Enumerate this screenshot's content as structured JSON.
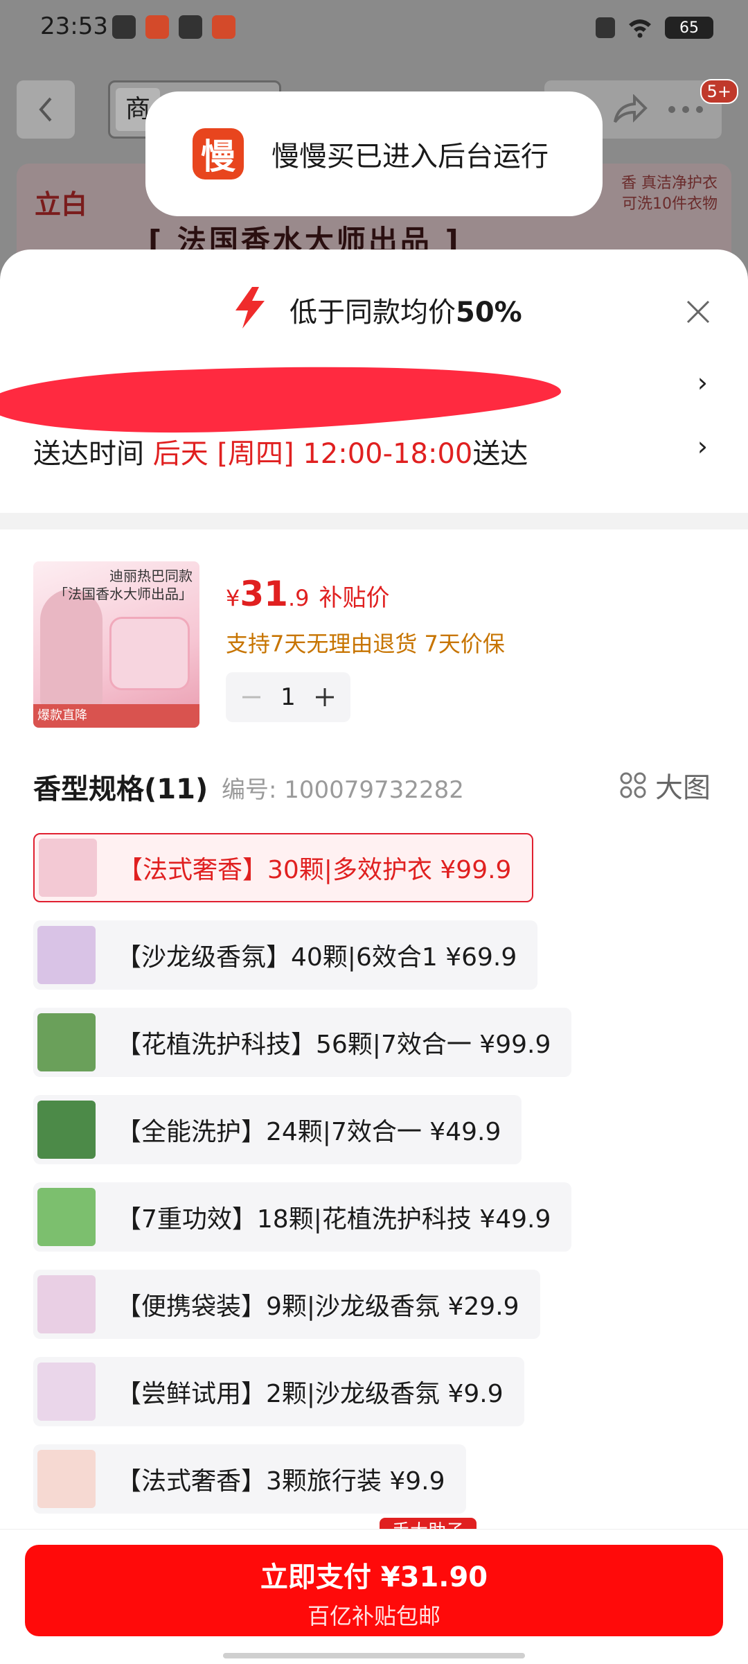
{
  "status_bar": {
    "time": "23:53",
    "battery": "65"
  },
  "background_page": {
    "search_tab": "商",
    "cart_badge": "5+",
    "banner_brand": "立白",
    "banner_title": "[ 法国香水大师出品 ]",
    "banner_right_line1": "香 真洁净护衣",
    "banner_right_line2": "可洗10件衣物"
  },
  "toast": {
    "logo_char": "慢",
    "message": "慢慢买已进入后台运行"
  },
  "sheet": {
    "title_prefix": "低于同款均价",
    "title_value": "50%",
    "delivery_label": "送达时间",
    "delivery_time": "后天 [周四] 12:00-18:00",
    "delivery_suffix": "送达",
    "chevron": "›"
  },
  "product": {
    "image_top_text1": "迪丽热巴同款",
    "image_top_text2": "「法国香水大师出品」",
    "image_tag": "爆款直降",
    "currency": "¥",
    "price_int": "31",
    "price_dec": ".9",
    "price_label": "补贴价",
    "guarantee": "支持7天无理由退货  7天价保",
    "qty": "1"
  },
  "spec": {
    "header": "香型规格(11)",
    "code": "编号: 100079732282",
    "big_image_label": "大图",
    "options": [
      {
        "label": "【法式奢香】30颗|多效护衣   ¥99.9",
        "selected": true,
        "thumb_color": "#f3c9d4"
      },
      {
        "label": "【沙龙级香氛】40颗|6效合1   ¥69.9",
        "selected": false,
        "thumb_color": "#d9c3e6"
      },
      {
        "label": "【花植洗护科技】56颗|7效合一   ¥99.9",
        "selected": false,
        "thumb_color": "#6aa05a"
      },
      {
        "label": "【全能洗护】24颗|7效合一   ¥49.9",
        "selected": false,
        "thumb_color": "#4c8a48"
      },
      {
        "label": "【7重功效】18颗|花植洗护科技   ¥49.9",
        "selected": false,
        "thumb_color": "#7cbf6e"
      },
      {
        "label": "【便携袋装】9颗|沙龙级香氛   ¥29.9",
        "selected": false,
        "thumb_color": "#e9cfe4"
      },
      {
        "label": "【尝鲜试用】2颗|沙龙级香氛   ¥9.9",
        "selected": false,
        "thumb_color": "#ead6ea"
      },
      {
        "label": "【法式奢香】3颗旅行装   ¥9.9",
        "selected": false,
        "thumb_color": "#f6d9d2"
      }
    ],
    "peek_tag": "手大助子"
  },
  "pay": {
    "main": "立即支付 ¥31.90",
    "sub": "百亿补贴包邮"
  },
  "colors": {
    "accent_red": "#e02020",
    "pay_red": "#ff0a0a",
    "orange_text": "#c77400"
  }
}
